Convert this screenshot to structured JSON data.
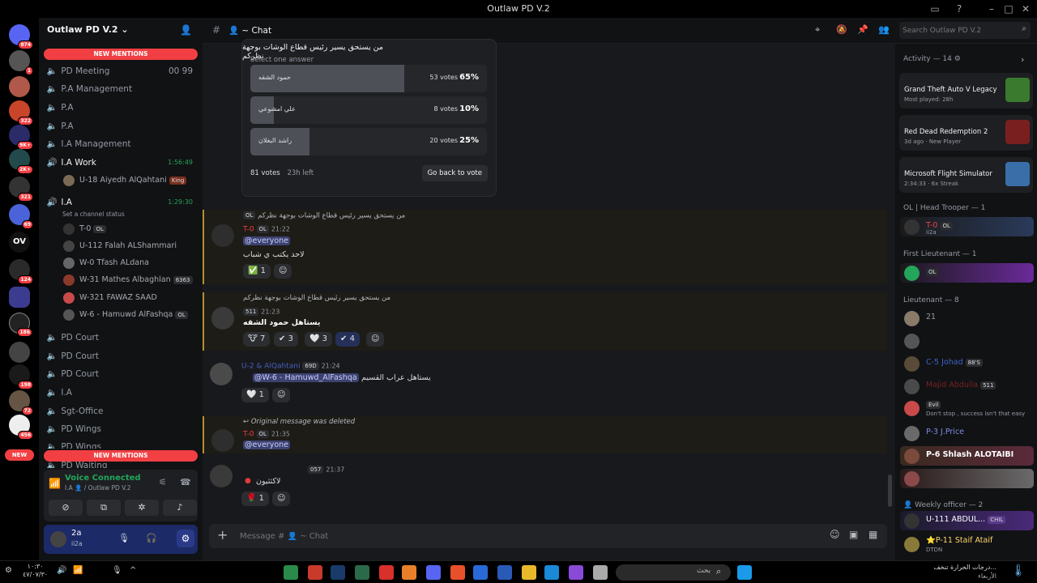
{
  "window": {
    "title": "Outlaw PD V.2"
  },
  "servers": {
    "badges": [
      "874",
      "1",
      "322",
      "9K+",
      "2K+",
      "321",
      "69",
      "OV",
      "124",
      "186",
      "198",
      "72",
      "456",
      "NEW"
    ]
  },
  "sidebar": {
    "server_name": "Outlaw PD V.2",
    "new_mentions_top": "NEW MENTIONS",
    "new_mentions_bottom": "NEW MENTIONS",
    "channels": [
      {
        "name": "PD Meeting",
        "counts": "00 99"
      },
      {
        "name": "P.A Management"
      },
      {
        "name": "P.A"
      },
      {
        "name": "P.A"
      },
      {
        "name": "I.A Management"
      },
      {
        "name": "I.A Work",
        "time": "1:56:49"
      },
      {
        "name": "I.A",
        "time": "1:29:30"
      },
      {
        "name": "PD Court"
      },
      {
        "name": "PD Court"
      },
      {
        "name": "PD Court"
      },
      {
        "name": "I.A"
      },
      {
        "name": "Sgt-Office"
      },
      {
        "name": "PD Wings"
      },
      {
        "name": "PD Wings"
      },
      {
        "name": "PD Waiting"
      }
    ],
    "work_member": {
      "name": "U-18 Aiyedh AlQahtani",
      "tag": "King"
    },
    "status_hint": "Set a channel status",
    "voice_members": [
      {
        "name": "T-0",
        "tag": "OL"
      },
      {
        "name": "U-112 Falah ALShammari"
      },
      {
        "name": "W-0 Tfash ALdana"
      },
      {
        "name": "W-31 Mathes Albaghlan",
        "tag": "6363"
      },
      {
        "name": "W-321 FAWAZ SAAD"
      },
      {
        "name": "W-6 - Hamuwd AlFashqa",
        "tag": "OL"
      }
    ],
    "voice_status": "Voice Connected",
    "voice_location": "I.A 👤 / Outlaw PD V.2",
    "user": {
      "name": "2a",
      "status": "ii2a"
    }
  },
  "header": {
    "channel": "👤 ~ Chat",
    "search_placeholder": "Search Outlaw PD V.2"
  },
  "poll": {
    "question": "من يستحق يسير رئيس قطاع الوشات بوجهة نظركم",
    "instruction": "Select one answer",
    "options": [
      {
        "label": "حمود الشقه",
        "votes": "53 votes",
        "pct": "65%",
        "fraction": 0.65
      },
      {
        "label": "علي امشوعي",
        "votes": "8 votes",
        "pct": "10%",
        "fraction": 0.1
      },
      {
        "label": "راشد البغلان",
        "votes": "20 votes",
        "pct": "25%",
        "fraction": 0.25
      }
    ],
    "total": "81 votes",
    "time_left": "23h left",
    "back_button": "Go back to vote"
  },
  "messages": [
    {
      "reply": "من يستحق يسير رئيس قطاع الوشات بوجهة نظركم",
      "author": "T-0",
      "tag": "OL",
      "time": "21:22",
      "mention": "@everyone",
      "text": "لاحد يكتب ي شباب",
      "reactions": [
        {
          "emoji": "✅",
          "count": "1"
        }
      ]
    },
    {
      "reply": "من يستحق يسير رئيس قطاع الوشات بوجهة نظركم",
      "author": "",
      "tag": "511",
      "time": "21:23",
      "text": "يستاهل حمود الشقه",
      "reactions": [
        {
          "emoji": "🐮",
          "count": "7"
        },
        {
          "emoji": "✔",
          "count": "3"
        },
        {
          "emoji": "🤍",
          "count": "3"
        },
        {
          "emoji": "✔",
          "count": "4"
        }
      ]
    },
    {
      "author": "U-2 & AlQahtani",
      "tag": "69D",
      "time": "21:24",
      "mention": "@W-6 - Hamuwd_AlFashqa",
      "text": "يستاهل عراب القسيم",
      "reactions": [
        {
          "emoji": "🤍",
          "count": "1"
        }
      ]
    },
    {
      "reply": "Original message was deleted",
      "author": "T-0",
      "tag": "OL",
      "time": "21:35",
      "mention": "@everyone",
      "reactions": []
    },
    {
      "author": "",
      "tag": "057",
      "time": "21:37",
      "text": "لاكثثيون",
      "reactions": [
        {
          "emoji": "🌹",
          "count": "1"
        }
      ]
    }
  ],
  "composer": {
    "placeholder": "Message # 👤 ~ Chat"
  },
  "right": {
    "activity_header": "Activity — 14",
    "activities": [
      {
        "game": "Grand Theft Auto V Legacy",
        "meta": "Most played: 28h",
        "color": "#3a7a2f"
      },
      {
        "game": "Red Dead Redemption 2",
        "meta": "3d ago · New Player",
        "color": "#7a1f1f"
      },
      {
        "game": "Microsoft Flight Simulator",
        "meta": "2:34:33 · 6x Streak",
        "color": "#3a6ea8"
      }
    ],
    "groups": [
      {
        "title": "OL | Head Trooper — 1"
      },
      {
        "title": "First Lieutenant — 1"
      },
      {
        "title": "Lieutenant — 8"
      },
      {
        "title": "Weekly officer — 2"
      }
    ],
    "members": [
      {
        "name": "T-0",
        "tag": "OL",
        "sub": "ii2a",
        "color": "#f23f43"
      },
      {
        "name": "",
        "tag": "OL",
        "color": "#c84cc4"
      },
      {
        "name": "21",
        "color": "#949ba4"
      },
      {
        "name": "",
        "color": "#949ba4"
      },
      {
        "name": "C-5 Johad",
        "tag": "88'S",
        "color": "#3c63c8"
      },
      {
        "name": "Majid Abdulla",
        "tag": "511",
        "color": "#7a2020"
      },
      {
        "name": "",
        "tag": "Evil",
        "sub": "Don't stop , success isn't that easy",
        "color": "#dbdee1"
      },
      {
        "name": "P-3 J.Price",
        "color": "#7f8ce8"
      },
      {
        "name": "P-6 Shlash ALOTAIBI",
        "color": "#ffffff"
      },
      {
        "name": "",
        "color": "#d14a4a"
      },
      {
        "name": "U-111 ABDUL...",
        "tag": "CHIL",
        "color": "#ffffff"
      },
      {
        "name": "P-11 Staif Ataif",
        "sub": "DTDN",
        "color": "#ffd76a"
      }
    ]
  },
  "taskbar": {
    "clock": "١٠:٣٠",
    "date": "٤٧/٠٧/٣٠",
    "search_placeholder": "بحث",
    "weather": "درجات الحرارة تنخف...",
    "weather_sub": "الأربعاء"
  }
}
